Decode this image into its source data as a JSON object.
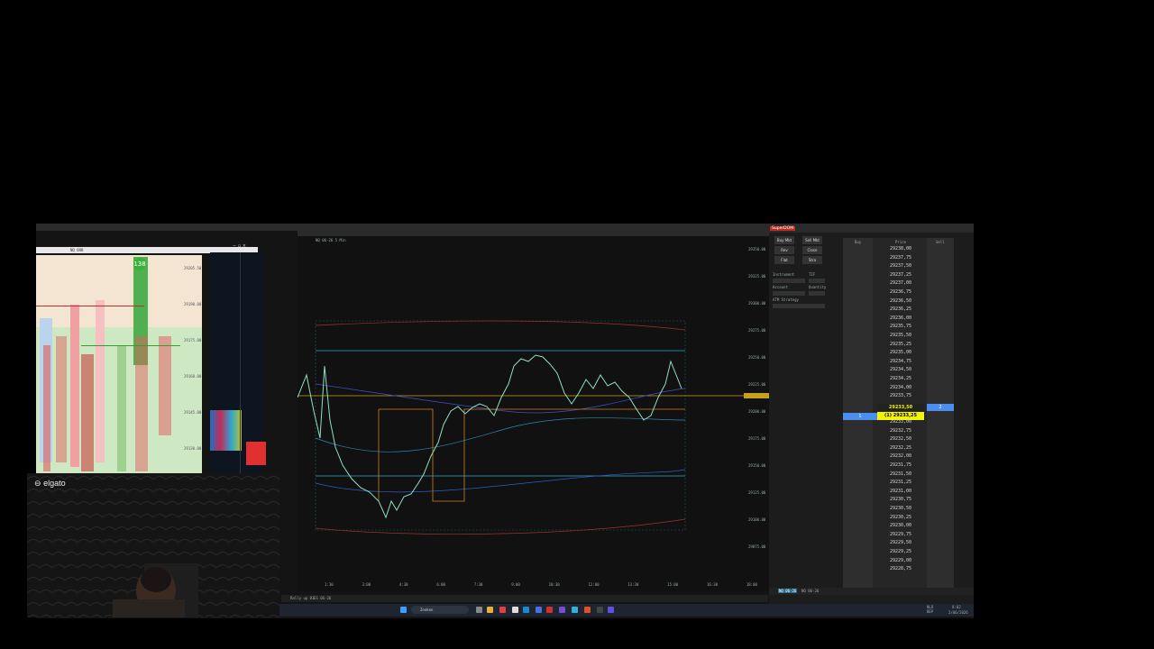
{
  "facecam": {
    "brand": "elgato"
  },
  "footprint": {
    "title": "NQ 09B",
    "badge": "138",
    "prices": [
      "29205.50",
      "29190.00",
      "29175.00",
      "29160.00",
      "29145.00",
      "29130.00"
    ]
  },
  "chart": {
    "title": "NQ 06-26 5 Min",
    "right_axis": [
      "29350.00",
      "29325.00",
      "29300.00",
      "29275.00",
      "29250.00",
      "29225.00",
      "29200.00",
      "29175.00",
      "29150.00",
      "29125.00",
      "29100.00",
      "29075.00",
      "29050.00"
    ],
    "time_axis": [
      "1:30",
      "3:00",
      "4:30",
      "6:00",
      "7:30",
      "9:00",
      "10:30",
      "12:00",
      "13:30",
      "15:00",
      "16:30",
      "18:00"
    ],
    "current_price": "29233.25",
    "tab": "NQ 06-26"
  },
  "dom": {
    "title": "SuperDOM",
    "buy_mkt": "Buy Mkt",
    "sell_mkt": "Sell Mkt",
    "rev": "Rev",
    "close": "Close",
    "flat": "Flat",
    "strategy": "Stra",
    "instrument_label": "Instrument",
    "tif_label": "TIF",
    "account_label": "Account",
    "quantity_label": "Quantity",
    "atm_label": "ATM Strategy",
    "col_buy": "Buy",
    "col_price": "Price",
    "col_sell": "Sell",
    "position_marker": "1",
    "ask_marker": "2",
    "current_price_label": "(1) 29233,25",
    "last_price_label": "29233,50",
    "prices": [
      "29238,00",
      "29237,75",
      "29237,50",
      "29237,25",
      "29237,00",
      "29236,75",
      "29236,50",
      "29236,25",
      "29236,00",
      "29235,75",
      "29235,50",
      "29235,25",
      "29235,00",
      "29234,75",
      "29234,50",
      "29234,25",
      "29234,00",
      "29233,75",
      "29233,50",
      "(1) 29233,25",
      "29233,00",
      "29232,75",
      "29232,50",
      "29232,25",
      "29232,00",
      "29231,75",
      "29231,50",
      "29231,25",
      "29231,00",
      "29230,75",
      "29230,50",
      "29230,25",
      "29230,00",
      "29229,75",
      "29229,50",
      "29229,25",
      "29229,00",
      "29228,75"
    ],
    "footer_tabs": [
      "NQ 06-26",
      "NQ 06-26"
    ]
  },
  "taskbar": {
    "search": "Zoeken",
    "time": "8:02",
    "date": "2/06/2026",
    "lang": "NLD\nBEP"
  },
  "bottom_tabs": [
    "Rally up 01",
    "ES 06-26"
  ],
  "colors": {
    "highlight_yellow": "#f4f400",
    "position_blue": "#4a8ff0",
    "bid_green": "#2eb82e",
    "price_line": "#c8a018"
  }
}
